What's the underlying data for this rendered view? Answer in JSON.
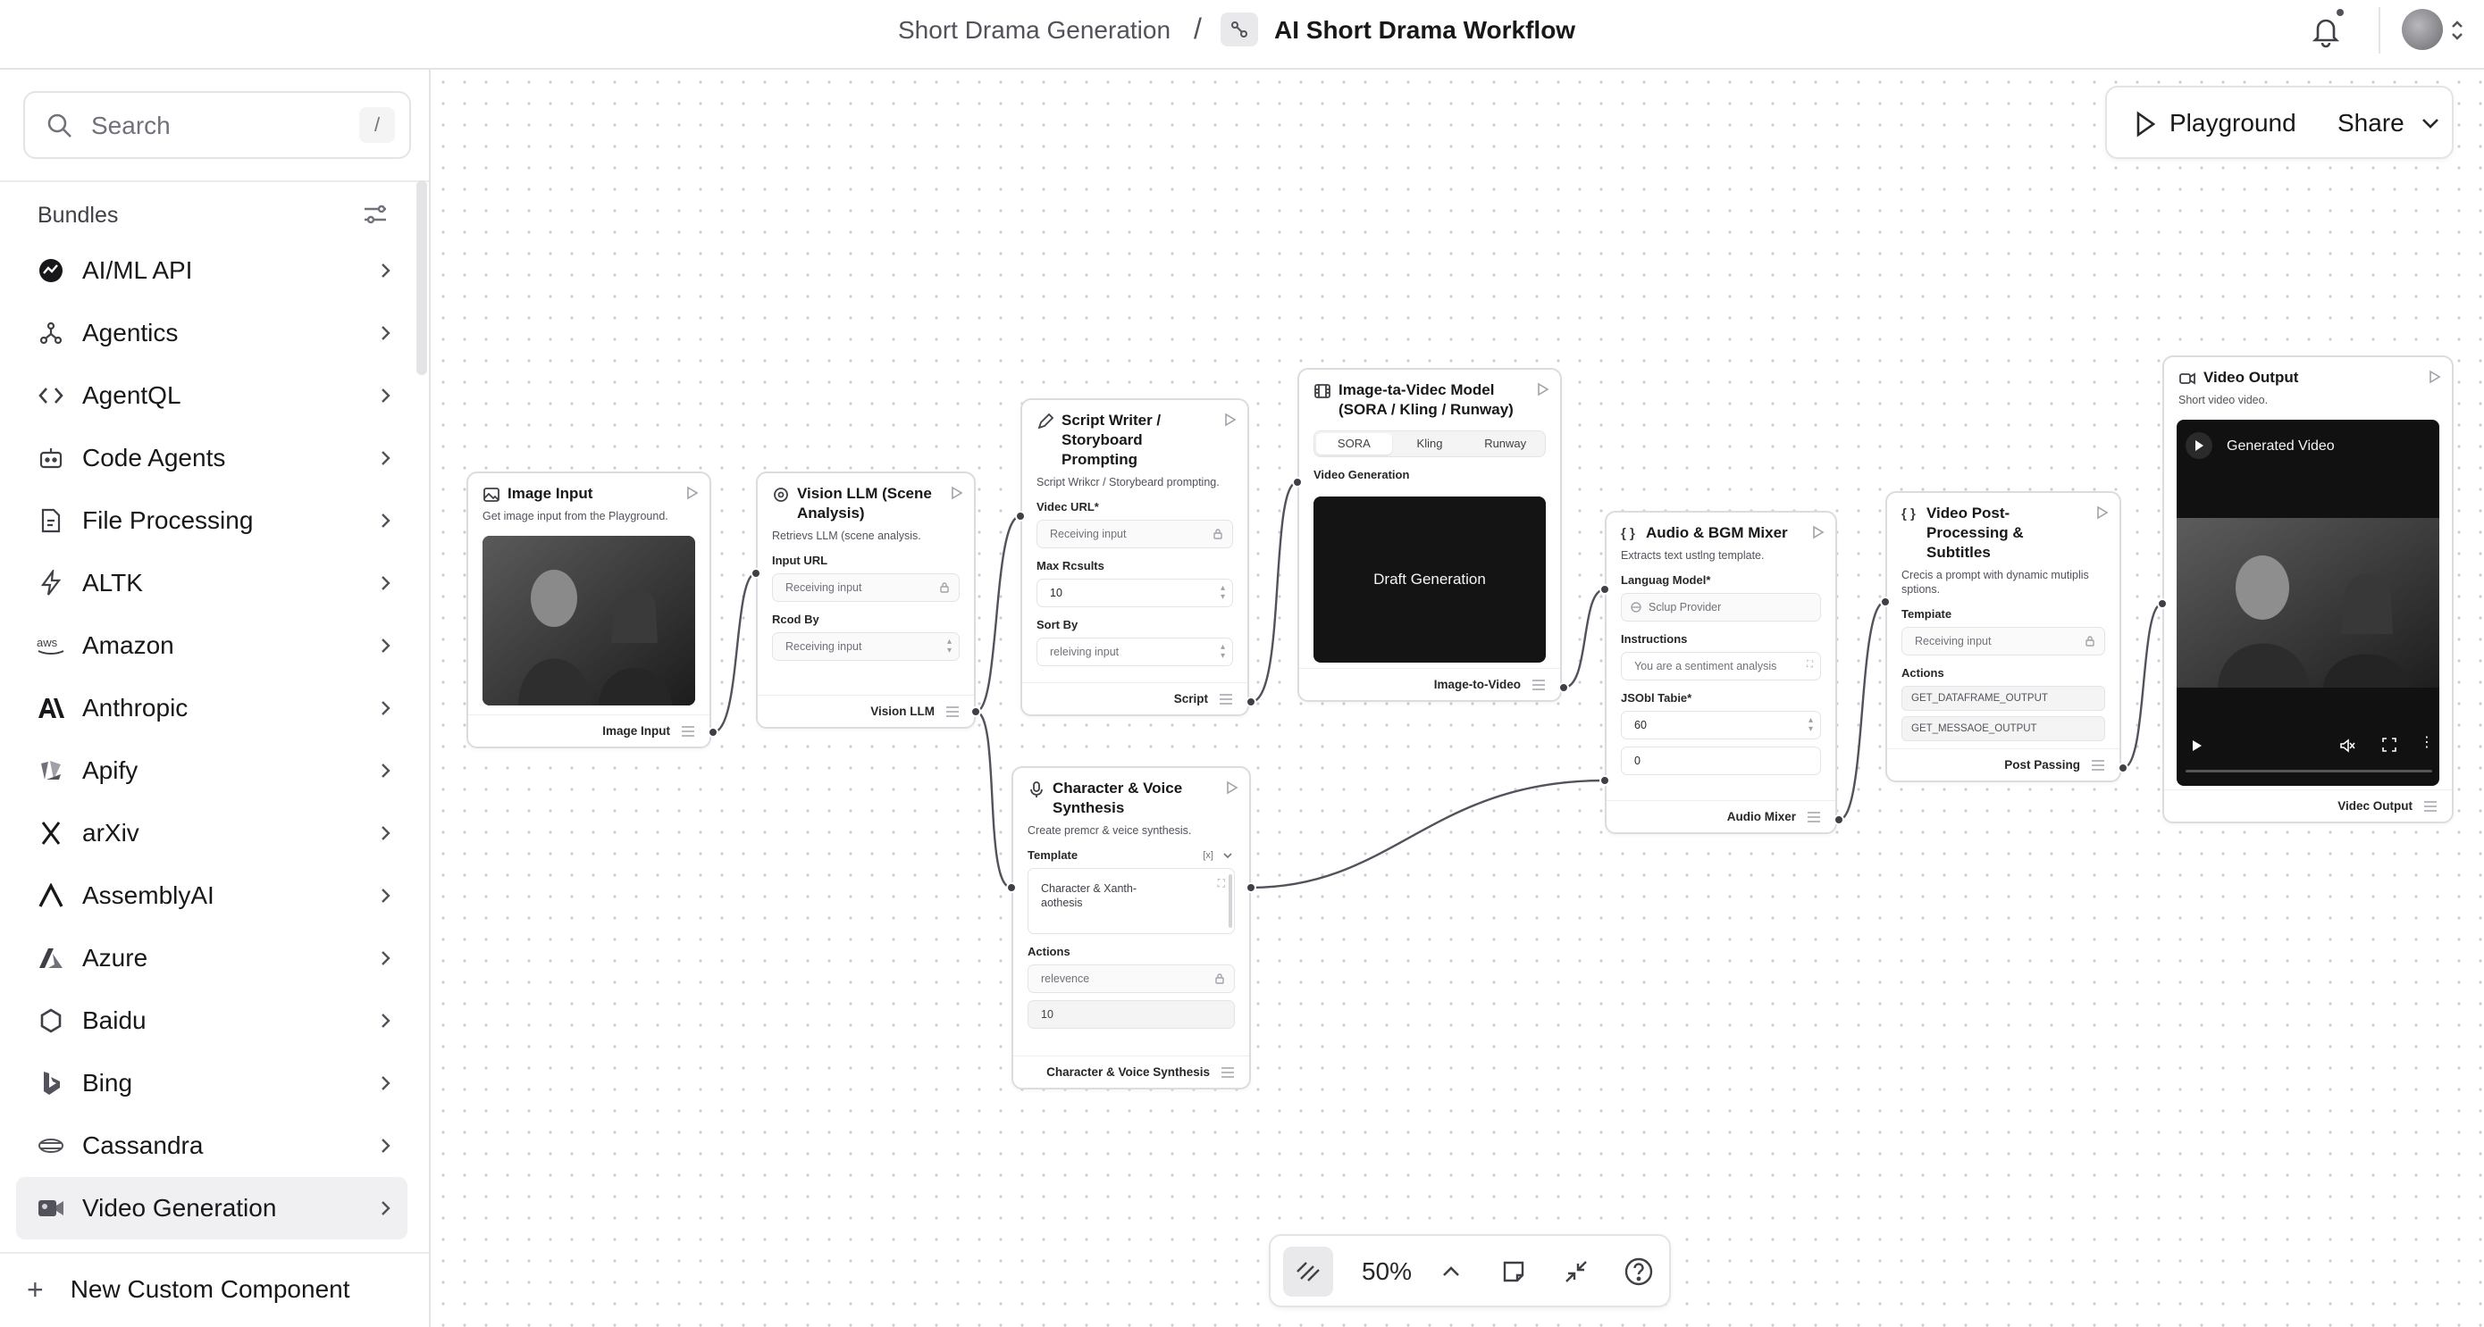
{
  "header": {
    "breadcrumb_parent": "Short Drama Generation",
    "breadcrumb_separator": "/",
    "flow_title": "AI Short Drama Workflow"
  },
  "sidebar": {
    "search_placeholder": "Search",
    "search_shortcut": "/",
    "bundles_label": "Bundles",
    "items": [
      {
        "label": "AI/ML API",
        "icon": "aiml-api-icon"
      },
      {
        "label": "Agentics",
        "icon": "agentics-icon"
      },
      {
        "label": "AgentQL",
        "icon": "code-brackets-icon"
      },
      {
        "label": "Code Agents",
        "icon": "robot-icon"
      },
      {
        "label": "File Processing",
        "icon": "file-icon"
      },
      {
        "label": "ALTK",
        "icon": "bolt-icon"
      },
      {
        "label": "Amazon",
        "icon": "aws-icon"
      },
      {
        "label": "Anthropic",
        "icon": "anthropic-icon"
      },
      {
        "label": "Apify",
        "icon": "apify-icon"
      },
      {
        "label": "arXiv",
        "icon": "arxiv-icon"
      },
      {
        "label": "AssemblyAI",
        "icon": "assemblyai-icon"
      },
      {
        "label": "Azure",
        "icon": "azure-icon"
      },
      {
        "label": "Baidu",
        "icon": "baidu-icon"
      },
      {
        "label": "Bing",
        "icon": "bing-icon"
      },
      {
        "label": "Cassandra",
        "icon": "cassandra-icon"
      },
      {
        "label": "Video Generation",
        "icon": "video-icon",
        "active": true
      }
    ],
    "new_component_label": "New Custom Component"
  },
  "canvas_actions": {
    "playground_label": "Playground",
    "share_label": "Share"
  },
  "nodes": {
    "image_input": {
      "title": "Image Input",
      "description": "Get image input from the Playground.",
      "output_label": "Image Input"
    },
    "vision_llm": {
      "title": "Vision LLM (Scene Analysis)",
      "description": "Retrievs LLM (scene analysis.",
      "field1_label": "Input URL",
      "field1_value": "Receiving input",
      "field2_label": "Rcod By",
      "field2_value": "Receiving input",
      "output_label": "Vision LLM"
    },
    "script_writer": {
      "title": "Script Writer / Storyboard Prompting",
      "description": "Script Wrikcr / Storybeard prompting.",
      "field1_label": "Videc URL*",
      "field1_value": "Receiving input",
      "field2_label": "Max Rcsults",
      "field2_value": "10",
      "field3_label": "Sort By",
      "field3_value": "releiving input",
      "output_label": "Script"
    },
    "image_to_video": {
      "title": "Image-ta-Videc Model (SORA / Kling / Runway)",
      "tabs": [
        "SORA",
        "Kling",
        "Runway"
      ],
      "field_label": "Video Generation",
      "preview_text": "Draft Generation",
      "output_label": "Image-to-Video"
    },
    "audio_mixer": {
      "title": "Audio & BGM Mixer",
      "description": "Extracts text ustlng template.",
      "field1_label": "Languag Model*",
      "field1_value": "Sclup Provider",
      "field2_label": "Instructions",
      "field2_value": "You are a sentiment analysis",
      "field3_label": "JSObl Tabie*",
      "field3_value": "60",
      "field4_value": "0",
      "output_label": "Audio Mixer"
    },
    "post_processing": {
      "title": "Video Post-Processing & Subtitles",
      "description": "Crecis a prompt with dynamic mutiplis sptions.",
      "field1_label": "Tempiate",
      "field1_value": "Receiving input",
      "field2_label": "Actions",
      "actions": [
        "GET_DATAFRAME_OUTPUT",
        "GET_MESSAOE_OUTPUT"
      ],
      "output_label": "Post Passing"
    },
    "video_output": {
      "title": "Video Output",
      "description": "Short video video.",
      "video_caption": "Generated Video",
      "output_label": "Videc Output"
    },
    "character_voice": {
      "title": "Character & Voice Synthesis",
      "description": "Create premcr & veice synthesis.",
      "field1_label": "Template",
      "field1_badge": "[x]",
      "field1_value": "Character & Xanth-aothesis",
      "field2_label": "Actions",
      "field2_value": "relevence",
      "field3_value": "10",
      "output_label": "Character & Voice Synthesis"
    }
  },
  "toolbar": {
    "zoom_level": "50%"
  }
}
